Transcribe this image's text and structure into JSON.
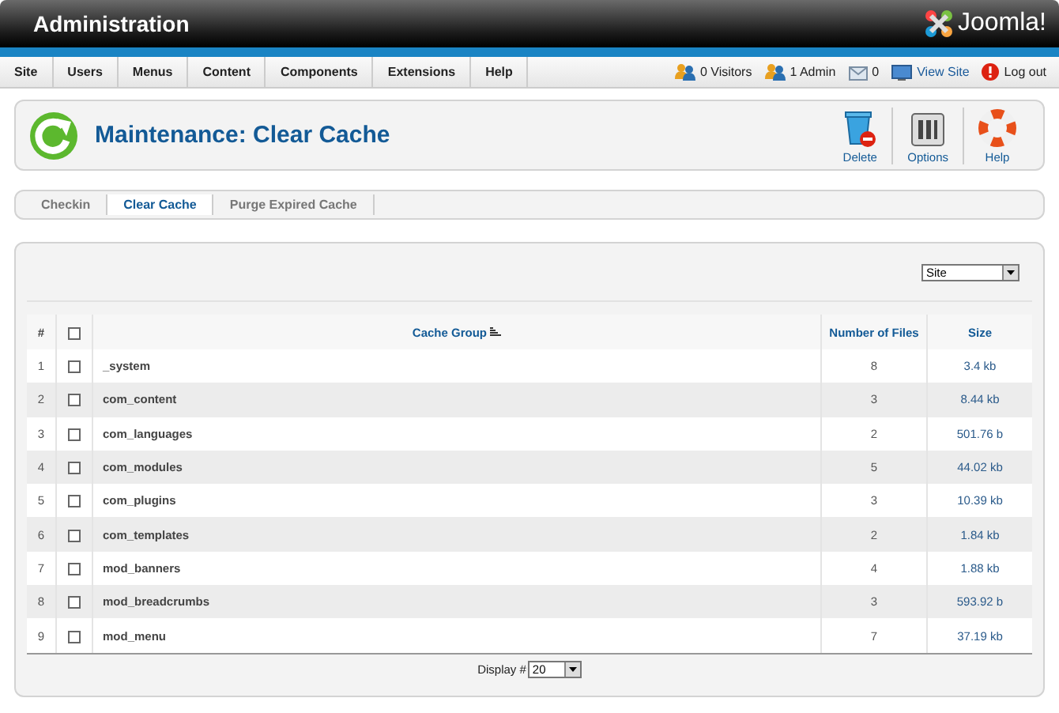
{
  "header": {
    "title": "Administration",
    "logo": "Joomla!"
  },
  "menu": [
    "Site",
    "Users",
    "Menus",
    "Content",
    "Components",
    "Extensions",
    "Help"
  ],
  "status": [
    {
      "kind": "visitors",
      "label": "0 Visitors"
    },
    {
      "kind": "admins",
      "label": "1 Admin"
    },
    {
      "kind": "messages",
      "label": "0"
    },
    {
      "kind": "view",
      "label": "View Site"
    },
    {
      "kind": "logout",
      "label": "Log out"
    }
  ],
  "toolbar": {
    "title": "Maintenance: Clear Cache",
    "buttons": [
      {
        "kind": "delete",
        "label": "Delete"
      },
      {
        "kind": "options",
        "label": "Options"
      },
      {
        "kind": "help",
        "label": "Help"
      }
    ]
  },
  "tabs": [
    {
      "label": "Checkin",
      "selected": false
    },
    {
      "label": "Clear Cache",
      "selected": true
    },
    {
      "label": "Purge Expired Cache",
      "selected": false
    }
  ],
  "filter": {
    "value": "Site"
  },
  "table": {
    "columns": [
      "#",
      "Cache Group",
      "Number of Files",
      "Size"
    ],
    "all_checked": false,
    "rows": [
      {
        "num": "1",
        "group": "_system",
        "files": "8",
        "size": "3.4 kb",
        "checked": false
      },
      {
        "num": "2",
        "group": "com_content",
        "files": "3",
        "size": "8.44 kb",
        "checked": false
      },
      {
        "num": "3",
        "group": "com_languages",
        "files": "2",
        "size": "501.76 b",
        "checked": false
      },
      {
        "num": "4",
        "group": "com_modules",
        "files": "5",
        "size": "44.02 kb",
        "checked": false
      },
      {
        "num": "5",
        "group": "com_plugins",
        "files": "3",
        "size": "10.39 kb",
        "checked": false
      },
      {
        "num": "6",
        "group": "com_templates",
        "files": "2",
        "size": "1.84 kb",
        "checked": false
      },
      {
        "num": "7",
        "group": "mod_banners",
        "files": "4",
        "size": "1.88 kb",
        "checked": false
      },
      {
        "num": "8",
        "group": "mod_breadcrumbs",
        "files": "3",
        "size": "593.92 b",
        "checked": false
      },
      {
        "num": "9",
        "group": "mod_menu",
        "files": "7",
        "size": "37.19 kb",
        "checked": false
      }
    ]
  },
  "pagination": {
    "label": "Display #",
    "value": "20"
  }
}
